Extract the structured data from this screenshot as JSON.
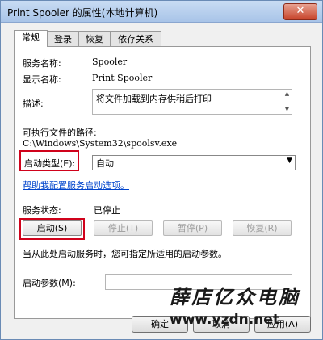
{
  "window": {
    "title": "Print Spooler 的属性(本地计算机)",
    "close_label": "✕"
  },
  "tabs": [
    {
      "label": "常规"
    },
    {
      "label": "登录"
    },
    {
      "label": "恢复"
    },
    {
      "label": "依存关系"
    }
  ],
  "general": {
    "service_name_label": "服务名称:",
    "service_name": "Spooler",
    "display_name_label": "显示名称:",
    "display_name": "Print Spooler",
    "description_label": "描述:",
    "description": "将文件加载到内存供稍后打印",
    "exe_path_label": "可执行文件的路径:",
    "exe_path": "C:\\Windows\\System32\\spoolsv.exe",
    "startup_type_label": "启动类型(E):",
    "startup_type_value": "自动",
    "help_link": "帮助我配置服务启动选项。",
    "status_label": "服务状态:",
    "status_value": "已停止",
    "start_button": "启动(S)",
    "stop_button": "停止(T)",
    "pause_button": "暂停(P)",
    "resume_button": "恢复(R)",
    "hint": "当从此处启动服务时，您可指定所适用的启动参数。",
    "params_label": "启动参数(M):",
    "params_value": ""
  },
  "footer": {
    "ok": "确定",
    "cancel": "取消",
    "apply": "应用(A)"
  },
  "watermark": {
    "text": "薛店亿众电脑",
    "url": "www.yzdn.net"
  },
  "colors": {
    "highlight": "#d0021b",
    "link": "#0044cc"
  }
}
